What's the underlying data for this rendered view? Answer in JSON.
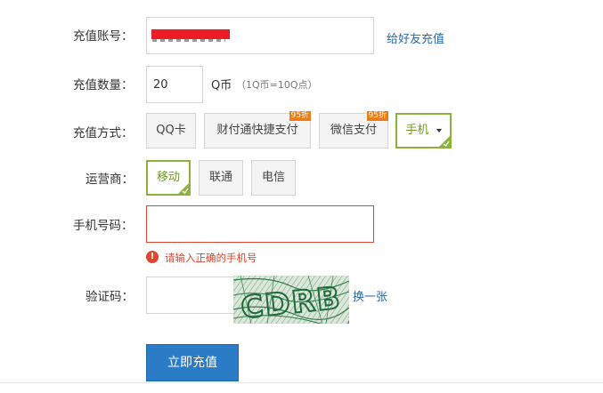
{
  "account": {
    "label": "充值账号：",
    "friend_link": "给好友充值"
  },
  "quantity": {
    "label": "充值数量：",
    "value": "20",
    "unit": "Q币",
    "note": "（1Q币=10Q点）"
  },
  "method": {
    "label": "充值方式：",
    "options": [
      {
        "label": "QQ卡"
      },
      {
        "label": "财付通快捷支付",
        "badge": "95折"
      },
      {
        "label": "微信支付",
        "badge": "95折"
      },
      {
        "label": "手机",
        "selected": true
      }
    ]
  },
  "carrier": {
    "label": "运营商：",
    "options": [
      {
        "label": "移动",
        "selected": true
      },
      {
        "label": "联通"
      },
      {
        "label": "电信"
      }
    ]
  },
  "phone": {
    "label": "手机号码：",
    "error": "请输入正确的手机号"
  },
  "captcha": {
    "label": "验证码：",
    "image_text": "CDRB",
    "refresh_link": "换一张"
  },
  "submit_label": "立即充值",
  "colors": {
    "accent_green": "#8ab23c",
    "error_red": "#e0452f",
    "badge_orange": "#f07c14",
    "primary_blue": "#2a7cc6",
    "link_blue": "#2b6aa5"
  }
}
